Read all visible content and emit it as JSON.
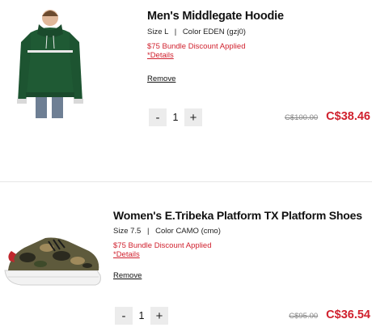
{
  "items": [
    {
      "name": "Men's Middlegate Hoodie",
      "size_label": "Size",
      "size": "L",
      "separator": "|",
      "color_label": "Color",
      "color": "EDEN (gzj0)",
      "promo": "$75 Bundle Discount Applied",
      "details_link": "*Details",
      "remove": "Remove",
      "qty_minus": "-",
      "qty": "1",
      "qty_plus": "+",
      "original_price": "C$100.00",
      "sale_price": "C$38.46",
      "image_icon": "green-hoodie-product-image"
    },
    {
      "name": "Women's E.Tribeka Platform TX Platform Shoes",
      "size_label": "Size",
      "size": "7.5",
      "separator": "|",
      "color_label": "Color",
      "color": "CAMO (cmo)",
      "promo": "$75 Bundle Discount Applied",
      "details_link": "*Details",
      "remove": "Remove",
      "qty_minus": "-",
      "qty": "1",
      "qty_plus": "+",
      "original_price": "C$95.00",
      "sale_price": "C$36.54",
      "image_icon": "camo-shoe-product-image"
    }
  ],
  "colors": {
    "accent_red": "#d0212e",
    "hoodie_green": "#1f5a34",
    "strike_gray": "#888888"
  }
}
